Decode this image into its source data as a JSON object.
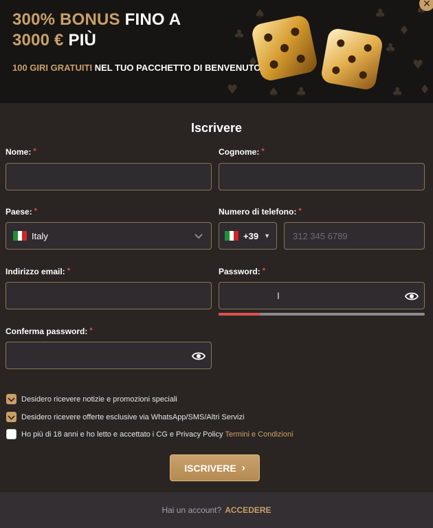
{
  "banner": {
    "bonus_gold_1": "300% BONUS",
    "bonus_white_1": "FINO A",
    "bonus_gold_2": "3000 €",
    "bonus_white_2": "PIÙ",
    "spins_gold": "100 GIRI GRATUITI",
    "spins_white": "NEL TUO PACCHETTO DI BENVENUTO"
  },
  "form": {
    "title": "Iscrivere",
    "required_mark": "*",
    "first_name": {
      "label": "Nome:",
      "value": ""
    },
    "last_name": {
      "label": "Cognome:",
      "value": ""
    },
    "country": {
      "label": "Paese:",
      "value": "Italy"
    },
    "phone": {
      "label": "Numero di telefono:",
      "prefix": "+39",
      "placeholder": "312 345 6789"
    },
    "email": {
      "label": "Indirizzo email:",
      "value": ""
    },
    "password": {
      "label": "Password:",
      "strength": 0.2
    },
    "confirm_password": {
      "label": "Conferma password:"
    },
    "checkboxes": [
      {
        "label": "Desidero ricevere notizie e promozioni speciali",
        "checked": true
      },
      {
        "label": "Desidero ricevere offerte esclusive via WhatsApp/SMS/Altri Servizi",
        "checked": true
      },
      {
        "label": "Ho più di 18 anni e ho letto e accettato i CG e Privacy Policy",
        "link": "Termini e Condizioni",
        "checked": false
      }
    ],
    "submit": "ISCRIVERE"
  },
  "footer": {
    "question": "Hai un account?",
    "login": "ACCEDERE"
  },
  "colors": {
    "accent": "#c9a06a",
    "background": "#2a2522",
    "error": "#d9534f"
  },
  "icons": [
    "close-icon",
    "dice-icon",
    "italy-flag-icon",
    "chevron-down-icon",
    "caret-down-icon",
    "eye-icon",
    "check-icon",
    "chevron-right-icon"
  ]
}
